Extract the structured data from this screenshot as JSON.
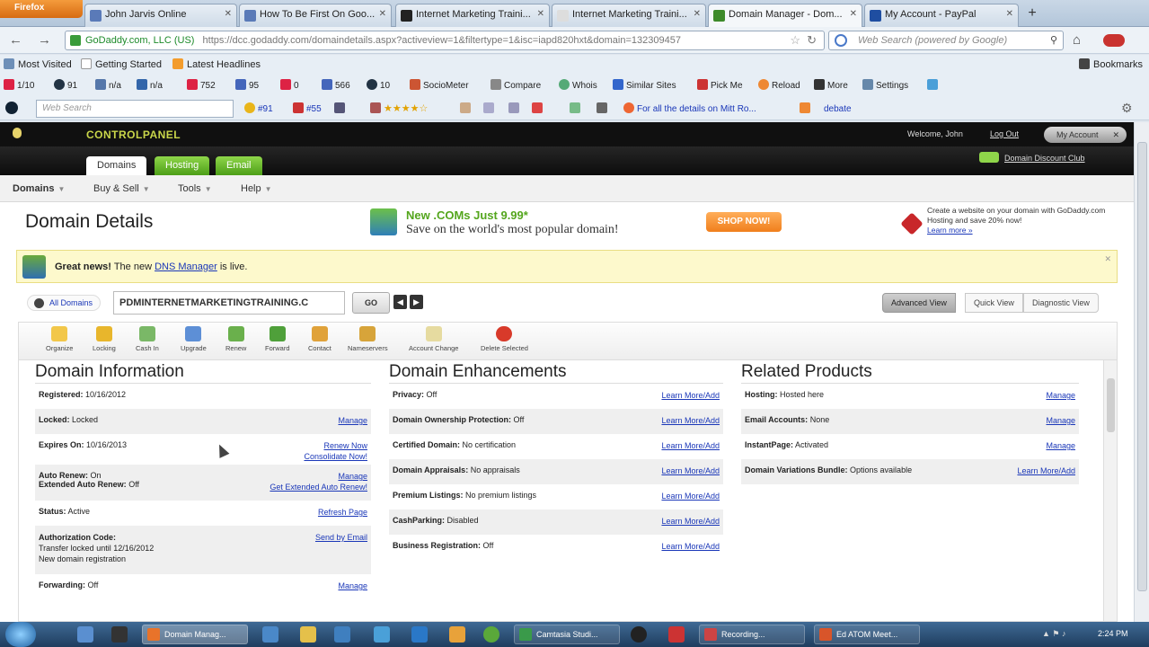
{
  "browser": {
    "firefox_label": "Firefox",
    "tabs": [
      {
        "label": "John Jarvis Online"
      },
      {
        "label": "How To Be First On Goo..."
      },
      {
        "label": "Internet Marketing Traini..."
      },
      {
        "label": "Internet Marketing Traini..."
      },
      {
        "label": "Domain Manager - Dom..."
      },
      {
        "label": "My Account - PayPal"
      }
    ],
    "url_site": "GoDaddy.com, LLC (US)",
    "url_path": "https://dcc.godaddy.com/domaindetails.aspx?activeview=1&filtertype=1&isc=iapd820hxt&domain=132309457",
    "search_placeholder": "Web Search (powered by Google)"
  },
  "bookmarks": {
    "most_visited": "Most Visited",
    "getting_started": "Getting Started",
    "latest_headlines": "Latest Headlines",
    "bookmarks": "Bookmarks"
  },
  "seo_toolbar": {
    "pr": "1/10",
    "a1": "91",
    "a2": "n/a",
    "a3": "n/a",
    "a4": "752",
    "a5": "95",
    "a6": "0",
    "a7": "566",
    "a8": "10",
    "sociometer": "SocioMeter",
    "compare": "Compare",
    "whois": "Whois",
    "similar_sites": "Similar Sites",
    "pick_me": "Pick Me",
    "reload": "Reload",
    "more": "More",
    "settings": "Settings"
  },
  "toolbar2": {
    "search_placeholder": "Web Search",
    "rank1": "#91",
    "rank2": "#55",
    "news": "For all the details on Mitt Ro...",
    "debate": "debate"
  },
  "godaddy": {
    "control_panel": "CONTROLPANEL",
    "welcome": "Welcome, John",
    "logout": "Log Out",
    "my_account": "My Account",
    "tabs": [
      "Domains",
      "Hosting",
      "Email"
    ],
    "discount_club": "Domain Discount Club",
    "menu": [
      "Domains",
      "Buy & Sell",
      "Tools",
      "Help"
    ]
  },
  "page": {
    "title": "Domain Details",
    "promo_head": "New .COMs Just 9.99*",
    "promo_sub": "Save on the world's most popular domain!",
    "shop_now": "SHOP NOW!",
    "side_promo": "Create a website on your domain with GoDaddy.com Hosting and save 20% now!",
    "learn_more": "Learn more »",
    "news_bold": "Great news!",
    "news_pre": " The new ",
    "news_link": "DNS Manager",
    "news_post": " is live.",
    "all_domains": "All Domains",
    "domain_value": "PDMINTERNETMARKETINGTRAINING.C",
    "go": "GO",
    "views": [
      "Advanced View",
      "Quick View",
      "Diagnostic View"
    ]
  },
  "actions": [
    "Organize",
    "Locking",
    "Cash In",
    "Upgrade",
    "Renew",
    "Forward",
    "Contact",
    "Nameservers",
    "Account Change",
    "Delete Selected"
  ],
  "domain_information": {
    "heading": "Domain Information",
    "rows": [
      {
        "label": "Registered:",
        "value": " 10/16/2012",
        "links": []
      },
      {
        "label": "Locked:",
        "value": " Locked",
        "links": [
          "Manage"
        ]
      },
      {
        "label": "Expires On:",
        "value": " 10/16/2013",
        "links": [
          "Renew Now",
          "Consolidate Now!"
        ]
      },
      {
        "label": "Auto Renew:",
        "value": " On",
        "label2": "Extended Auto Renew:",
        "value2": " Off",
        "links": [
          "Manage",
          "Get Extended Auto Renew!"
        ]
      },
      {
        "label": "Status:",
        "value": " Active",
        "links": [
          "Refresh Page"
        ]
      },
      {
        "label": "Authorization Code:",
        "value": "",
        "line2": "Transfer locked until 12/16/2012",
        "line3": "New domain registration",
        "links": [
          "Send by Email"
        ]
      },
      {
        "label": "Forwarding:",
        "value": " Off",
        "links": [
          "Manage"
        ]
      }
    ]
  },
  "domain_enhancements": {
    "heading": "Domain Enhancements",
    "link": "Learn More/Add",
    "rows": [
      {
        "label": "Privacy:",
        "value": " Off"
      },
      {
        "label": "Domain Ownership Protection:",
        "value": " Off"
      },
      {
        "label": "Certified Domain:",
        "value": " No certification"
      },
      {
        "label": "Domain Appraisals:",
        "value": " No appraisals"
      },
      {
        "label": "Premium Listings:",
        "value": " No premium listings"
      },
      {
        "label": "CashParking:",
        "value": " Disabled"
      },
      {
        "label": "Business Registration:",
        "value": " Off"
      }
    ]
  },
  "related_products": {
    "heading": "Related Products",
    "rows": [
      {
        "label": "Hosting:",
        "value": " Hosted here",
        "link": "Manage"
      },
      {
        "label": "Email Accounts:",
        "value": " None",
        "link": "Manage"
      },
      {
        "label": "InstantPage:",
        "value": " Activated",
        "link": "Manage"
      },
      {
        "label": "Domain Variations Bundle:",
        "value": " Options available",
        "link": "Learn More/Add"
      }
    ]
  },
  "taskbar": {
    "items": [
      "Domain Manag...",
      "Camtasia Studi...",
      "Recording...",
      "Ed ATOM Meet..."
    ],
    "clock": "2:24 PM"
  }
}
